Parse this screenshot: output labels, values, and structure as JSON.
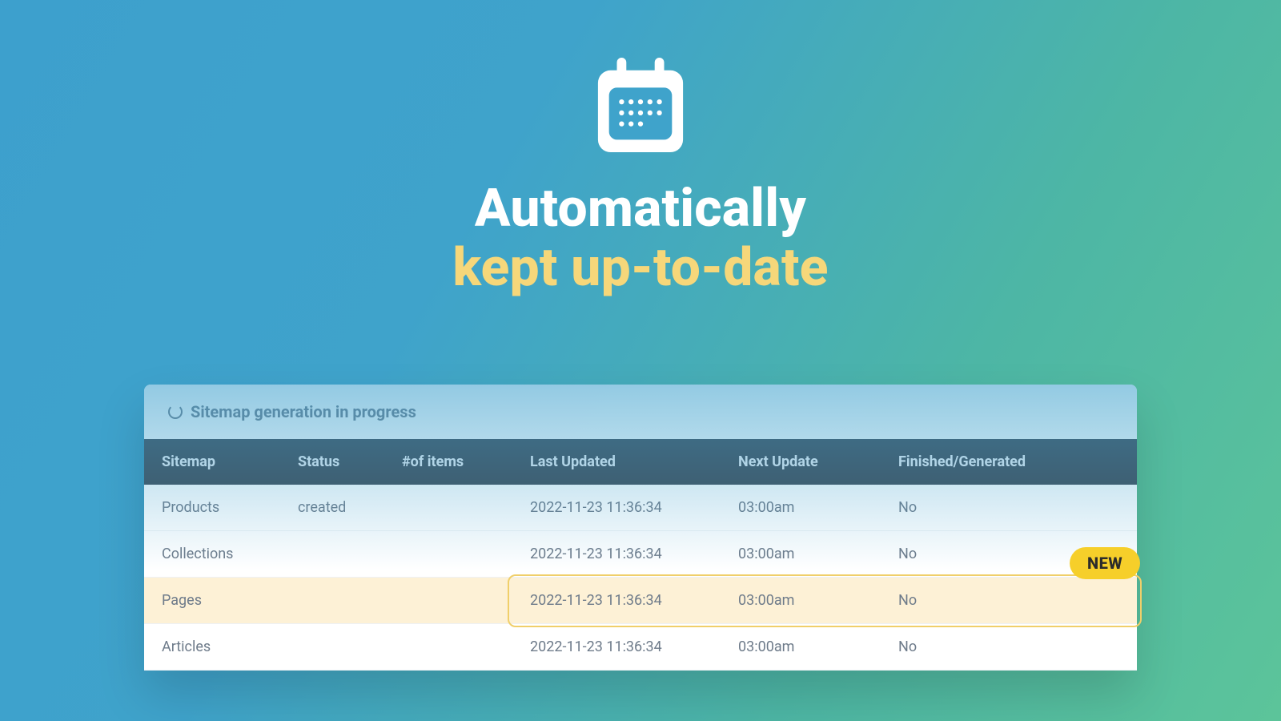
{
  "hero": {
    "headline_line1": "Automatically",
    "headline_line2": "kept up-to-date"
  },
  "panel": {
    "status_text": "Sitemap generation in progress",
    "new_badge": "NEW",
    "columns": {
      "sitemap": "Sitemap",
      "status": "Status",
      "items": "#of items",
      "last_updated": "Last Updated",
      "next_update": "Next Update",
      "finished": "Finished/Generated"
    },
    "rows": [
      {
        "sitemap": "Products",
        "status": "created",
        "items": "",
        "last_updated": "2022-11-23 11:36:34",
        "next_update": "03:00am",
        "finished": "No",
        "highlight": false
      },
      {
        "sitemap": "Collections",
        "status": "",
        "items": "",
        "last_updated": "2022-11-23 11:36:34",
        "next_update": "03:00am",
        "finished": "No",
        "highlight": false
      },
      {
        "sitemap": "Pages",
        "status": "",
        "items": "",
        "last_updated": "2022-11-23 11:36:34",
        "next_update": "03:00am",
        "finished": "No",
        "highlight": true
      },
      {
        "sitemap": "Articles",
        "status": "",
        "items": "",
        "last_updated": "2022-11-23 11:36:34",
        "next_update": "03:00am",
        "finished": "No",
        "highlight": false
      }
    ]
  },
  "colors": {
    "accent_yellow": "#f6d77a",
    "badge_yellow": "#f6cf2a",
    "header_dark": "#3f4a55",
    "bg_from": "#3da0cd",
    "bg_to": "#5cc49a"
  }
}
